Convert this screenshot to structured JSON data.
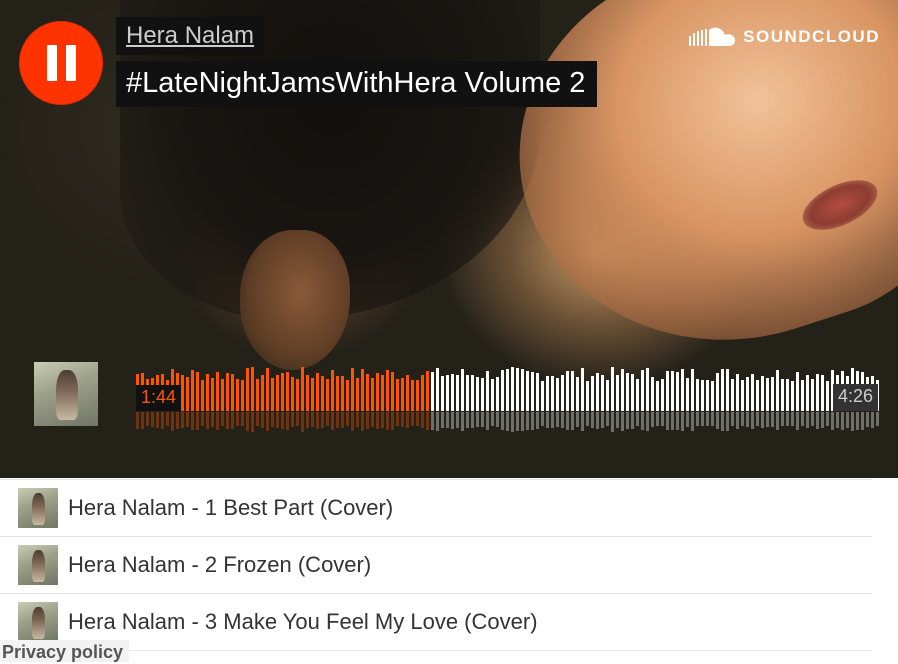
{
  "player": {
    "artist": "Hera Nalam",
    "title": "#LateNightJamsWithHera Volume 2",
    "state_icon": "pause-icon",
    "accent_color": "#ff5500",
    "play_button_color": "#ff3300"
  },
  "brand": {
    "logo_text": "SOUNDCLOUD",
    "icon": "soundcloud-cloud-icon"
  },
  "waveform": {
    "elapsed": "1:44",
    "total": "4:26",
    "played_fraction": 0.39,
    "played_color": "#ff5500",
    "unplayed_color": "#ffffff"
  },
  "tracks": [
    {
      "label": "Hera Nalam - 1 Best Part (Cover)"
    },
    {
      "label": "Hera Nalam - 2 Frozen (Cover)"
    },
    {
      "label": "Hera Nalam - 3 Make You Feel My Love (Cover)"
    }
  ],
  "footer": {
    "privacy": "Privacy policy"
  }
}
